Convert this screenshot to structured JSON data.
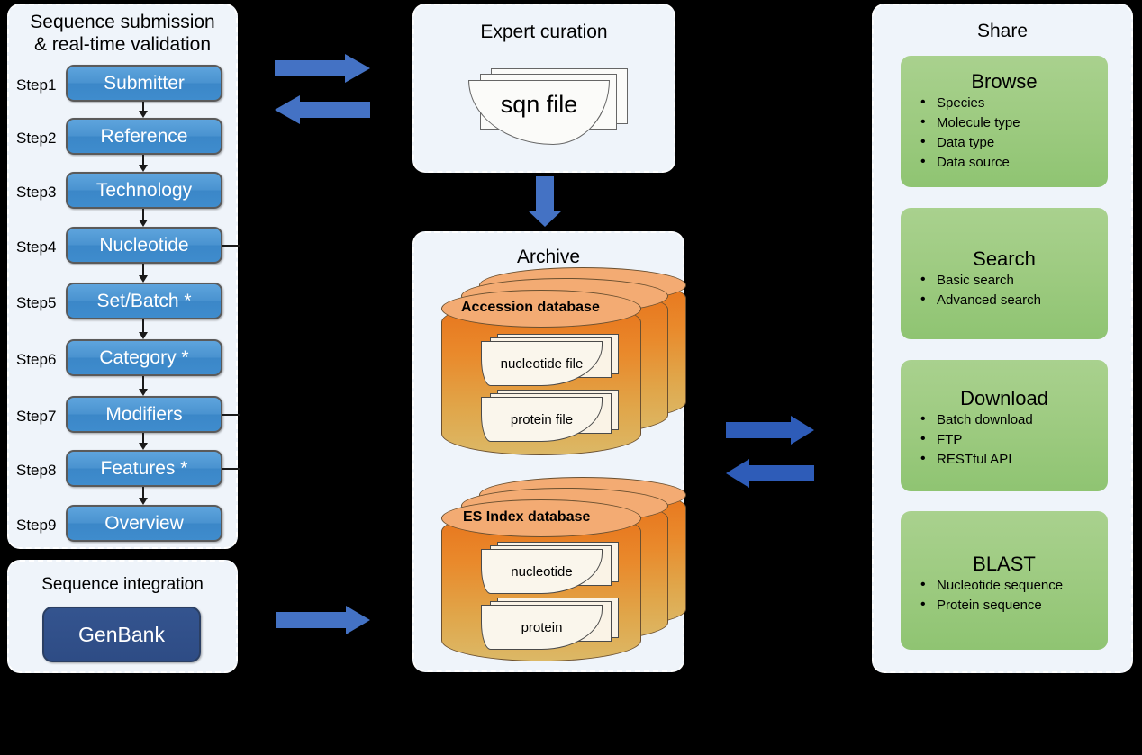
{
  "background_color": "#000000",
  "panel_bg": "#eff4fa",
  "colors": {
    "arrow_blue": "#4472c4",
    "step_blue": "#4a93d0",
    "genbank_blue": "#2e4c85",
    "share_green": "#9cca7f",
    "database_orange": "#e8741c"
  },
  "submission": {
    "title_line1": "Sequence submission",
    "title_line2": "& real-time validation",
    "steps": [
      {
        "step": "Step1",
        "label": "Submitter"
      },
      {
        "step": "Step2",
        "label": "Reference"
      },
      {
        "step": "Step3",
        "label": "Technology"
      },
      {
        "step": "Step4",
        "label": "Nucleotide"
      },
      {
        "step": "Step5",
        "label": "Set/Batch *"
      },
      {
        "step": "Step6",
        "label": "Category *"
      },
      {
        "step": "Step7",
        "label": "Modifiers"
      },
      {
        "step": "Step8",
        "label": "Features *"
      },
      {
        "step": "Step9",
        "label": "Overview"
      }
    ]
  },
  "integration": {
    "title": "Sequence integration",
    "button_label": "GenBank"
  },
  "curation": {
    "title": "Expert curation",
    "file_label": "sqn file"
  },
  "archive": {
    "title": "Archive",
    "databases": [
      {
        "name": "Accession database",
        "files": [
          "nucleotide file",
          "protein file"
        ]
      },
      {
        "name": "ES Index database",
        "files": [
          "nucleotide",
          "protein"
        ]
      }
    ]
  },
  "share": {
    "title": "Share",
    "boxes": [
      {
        "title": "Browse",
        "items": [
          "Species",
          "Molecule type",
          "Data type",
          "Data source"
        ]
      },
      {
        "title": "Search",
        "items": [
          "Basic search",
          "Advanced search"
        ]
      },
      {
        "title": "Download",
        "items": [
          "Batch download",
          "FTP",
          "RESTful API"
        ]
      },
      {
        "title": "BLAST",
        "items": [
          "Nucleotide sequence",
          "Protein sequence"
        ]
      }
    ]
  },
  "arrows": [
    {
      "name": "submission-to-curation",
      "direction": "right"
    },
    {
      "name": "curation-to-submission",
      "direction": "left"
    },
    {
      "name": "curation-to-archive",
      "direction": "down"
    },
    {
      "name": "archive-to-share",
      "direction": "right"
    },
    {
      "name": "share-to-archive",
      "direction": "left"
    },
    {
      "name": "genbank-to-archive",
      "direction": "right"
    }
  ]
}
